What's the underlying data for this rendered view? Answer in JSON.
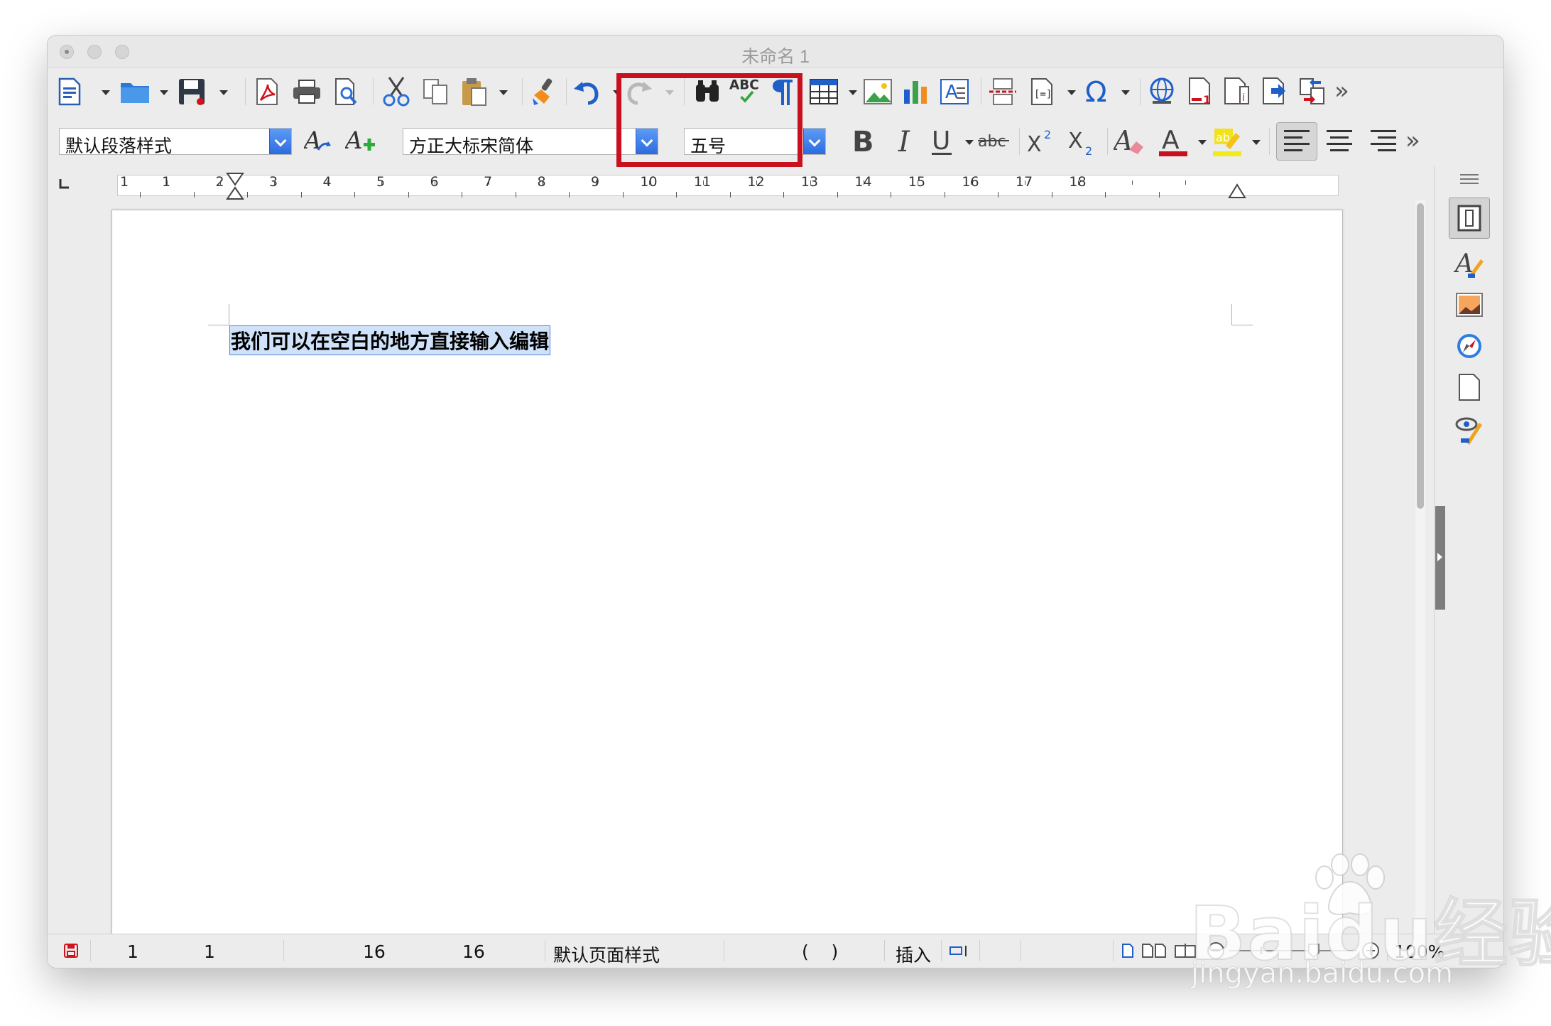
{
  "window": {
    "title": "未命名 1"
  },
  "formatting": {
    "paragraph_style": "默认段落样式",
    "font_name": "方正大标宋简体",
    "font_size": "五号"
  },
  "ruler": {
    "labels": [
      "1",
      "1",
      "2",
      "3",
      "4",
      "5",
      "6",
      "7",
      "8",
      "9",
      "10",
      "11",
      "12",
      "13",
      "14",
      "15",
      "16",
      "17",
      "18"
    ]
  },
  "document": {
    "text": "我们可以在空白的地方直接输入编辑"
  },
  "statusbar": {
    "page": "1",
    "pages": "1",
    "words": "16",
    "chars": "16",
    "page_style": "默认页面样式",
    "language": "(    )",
    "mode": "插入",
    "zoom": "100%"
  },
  "watermark": {
    "brand": "Baidu经验",
    "url": "jingyan.baidu.com"
  },
  "colors": {
    "highlight_box": "#c8101e",
    "selection": "#cfe2f9",
    "accent": "#2c6be0"
  }
}
